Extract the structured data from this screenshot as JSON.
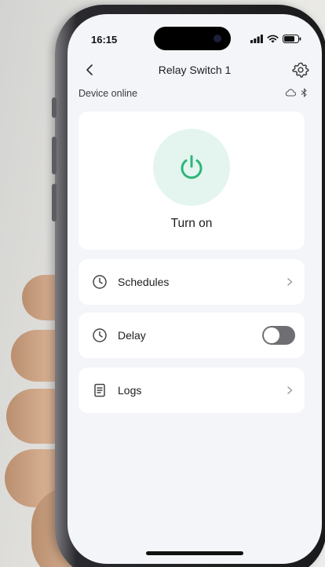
{
  "status_bar": {
    "time": "16:15"
  },
  "header": {
    "title": "Relay Switch 1"
  },
  "device": {
    "status": "Device online"
  },
  "power": {
    "label": "Turn on",
    "accent_color": "#2fb57a"
  },
  "menu": [
    {
      "label": "Schedules",
      "icon": "clock-icon"
    },
    {
      "label": "Delay",
      "icon": "timer-icon"
    },
    {
      "label": "Logs",
      "icon": "document-icon"
    }
  ],
  "delay_toggle": {
    "enabled": false
  }
}
